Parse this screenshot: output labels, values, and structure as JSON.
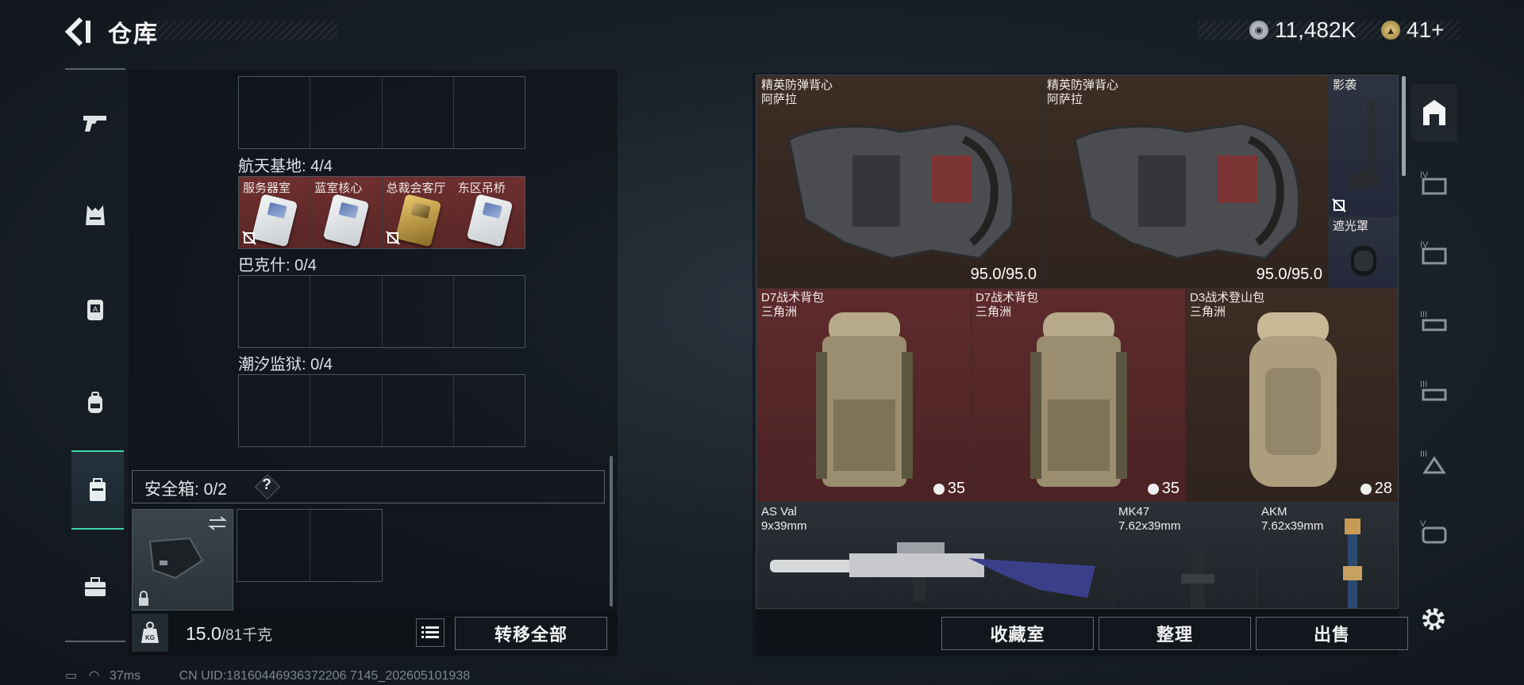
{
  "header": {
    "title": "仓库"
  },
  "currency": {
    "silver": "11,482K",
    "gold": "41+"
  },
  "left_rail": [
    {
      "name": "rail-item-weapons",
      "icon": "pistol-icon"
    },
    {
      "name": "rail-item-armor",
      "icon": "vest-icon"
    },
    {
      "name": "rail-item-chest-rig",
      "icon": "chest-rig-icon"
    },
    {
      "name": "rail-item-backpack",
      "icon": "backpack-icon"
    },
    {
      "name": "rail-item-container",
      "icon": "container-icon",
      "active": true
    },
    {
      "name": "rail-item-toolbox",
      "icon": "toolbox-icon"
    }
  ],
  "key_groups": [
    {
      "label": "航天基地: 4/4",
      "cells": [
        "服务器室",
        "蓝室核心",
        "总裁会客厅",
        "东区吊桥"
      ]
    },
    {
      "label": "巴克什: 0/4",
      "cells": []
    },
    {
      "label": "潮汐监狱: 0/4",
      "cells": []
    }
  ],
  "safebox": {
    "label": "安全箱: 0/2",
    "help": "?"
  },
  "weight": {
    "current": "15.0",
    "max": "/81千克"
  },
  "buttons": {
    "transfer_all": "转移全部",
    "collection": "收藏室",
    "sort": "整理",
    "sell": "出售"
  },
  "status": {
    "ping": "37ms",
    "uid": "CN UID:18160446936372206 7145_202605101938"
  },
  "stash_items": [
    {
      "name": "精英防弹背心",
      "sub": "阿萨拉",
      "value": "95.0/95.0"
    },
    {
      "name": "精英防弹背心",
      "sub": "阿萨拉",
      "value": "95.0/95.0"
    },
    {
      "name": "影袭",
      "sub": ""
    },
    {
      "name": "遮光罩",
      "sub": ""
    },
    {
      "name": "D7战术背包",
      "sub": "三角洲",
      "value": "35"
    },
    {
      "name": "D7战术背包",
      "sub": "三角洲",
      "value": "35"
    },
    {
      "name": "D3战术登山包",
      "sub": "三角洲",
      "value": "28"
    },
    {
      "name": "AS Val",
      "sub": "9x39mm"
    },
    {
      "name": "MK47",
      "sub": "7.62x39mm"
    },
    {
      "name": "AKM",
      "sub": "7.62x39mm"
    }
  ],
  "right_tabs": [
    "all-items-tab",
    "tier-iv-tab",
    "tier-iv-tab-2",
    "tier-iii-tab",
    "tier-iii-tab-2",
    "tier-iii-tab-3",
    "tier-v-tab"
  ],
  "colors": {
    "accent": "#3bd6a6",
    "red_rarity": "#5e2b2d",
    "brown_rarity": "#3d2d24"
  }
}
